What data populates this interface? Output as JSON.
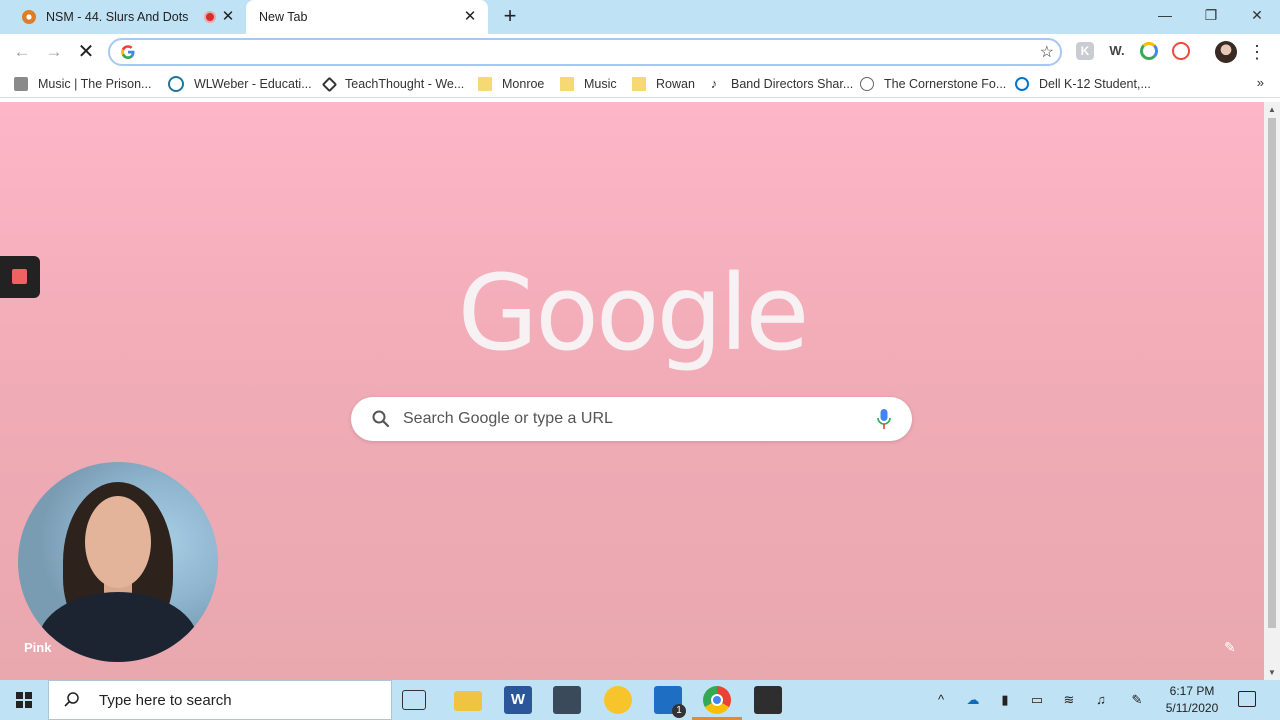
{
  "tabs": [
    {
      "title": "NSM - 44. Slurs And Dots",
      "icon": "pressbooks-icon",
      "recording": true
    },
    {
      "title": "New Tab",
      "icon": "none",
      "active": true
    }
  ],
  "window_controls": {
    "minimize": "—",
    "maximize": "❐",
    "close": "✕"
  },
  "toolbar": {
    "back": "←",
    "forward": "→",
    "stop": "✕",
    "omnibox_value": "",
    "star": "☆",
    "extensions": [
      "K",
      "W.",
      "",
      ""
    ],
    "menu": "⋮"
  },
  "bookmarks": [
    {
      "label": "Music | The Prison...",
      "icon": "site-icon"
    },
    {
      "label": "WLWeber - Educati...",
      "icon": "wordpress-icon"
    },
    {
      "label": "TeachThought - We...",
      "icon": "teachthought-icon"
    },
    {
      "label": "Monroe",
      "icon": "folder-icon"
    },
    {
      "label": "Music",
      "icon": "folder-icon"
    },
    {
      "label": "Rowan",
      "icon": "folder-icon"
    },
    {
      "label": "Band Directors Shar...",
      "icon": "music-icon"
    },
    {
      "label": "The Cornerstone Fo...",
      "icon": "site-icon"
    },
    {
      "label": "Dell K-12 Student,...",
      "icon": "dell-icon"
    }
  ],
  "bookmarks_more": "»",
  "newtab": {
    "logo": "Google",
    "search_placeholder": "Search Google or type a URL",
    "theme_label": "Pink",
    "background_top": "#fdb6c8",
    "background_bottom": "#e9a7ae"
  },
  "taskbar": {
    "search_placeholder": "Type here to search",
    "apps": [
      "task-view",
      "file-explorer",
      "word",
      "app",
      "notifications-app",
      "mail",
      "chrome",
      "sticky-notes"
    ],
    "mail_badge": "1",
    "time": "6:17 PM",
    "date": "5/11/2020"
  },
  "colors": {
    "tabstrip": "#bfe2f5",
    "accent": "#4285f4",
    "record": "#f06262"
  }
}
